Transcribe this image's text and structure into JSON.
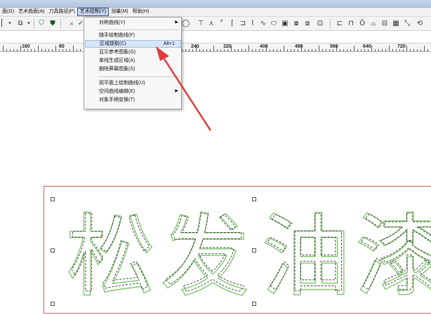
{
  "menubar": {
    "items": [
      "面(G)",
      "艺术曲面(A)",
      "刀具路径(P)",
      "艺术绘制(Y)",
      "测量(M)",
      "帮助(H)"
    ]
  },
  "dropdown": {
    "items": [
      {
        "label": "对称曲线(Y)"
      },
      {
        "label": "随手绘制曲线(F)"
      },
      {
        "label": "区域提取(C)",
        "shortcut": "Alt+1"
      },
      {
        "label": "显示参考图象(G)"
      },
      {
        "label": "单线生成区域(A)"
      },
      {
        "label": "删除屏幕图象(S)"
      },
      {
        "label": "视平面上绘制曲线(U)"
      },
      {
        "label": "空间曲线编辑(E)"
      },
      {
        "label": "对象手柄变换(T)"
      }
    ]
  },
  "ruler": {
    "labels": [
      "160",
      "80",
      "240",
      "320",
      "400",
      "480",
      "560",
      "640",
      "720"
    ]
  },
  "canvas": {
    "characters": [
      "松",
      "发",
      "油",
      "漆"
    ],
    "outline_colors": {
      "outer": "#6fbf5a",
      "inner": "#333333",
      "frame": "#c96464"
    }
  },
  "annotation": {
    "arrow_color": "#e03b3b"
  }
}
